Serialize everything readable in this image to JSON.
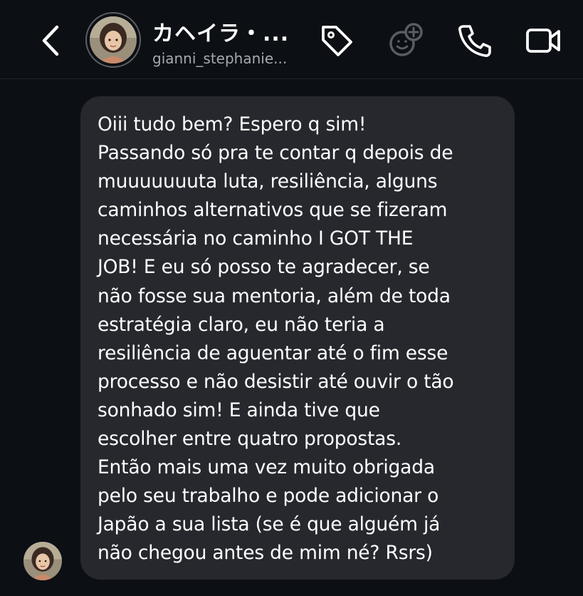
{
  "header": {
    "back_icon": "chevron-left-icon",
    "name": "カヘイラ・...",
    "username": "gianni_stephanie...",
    "icons": [
      "tag-icon",
      "add-sticker-icon",
      "phone-icon",
      "video-camera-icon"
    ]
  },
  "message": {
    "lines": [
      "Oiii tudo bem? Espero q sim!",
      "Passando só pra te contar q depois de",
      "muuuuuuuta luta, resiliência, alguns",
      "caminhos alternativos que se fizeram",
      "necessária no caminho I GOT THE",
      "JOB! E eu só posso te agradecer, se",
      "não fosse sua mentoria, além de toda",
      "estratégia claro, eu não teria a",
      "resiliência de aguentar até o fim esse",
      "processo e não desistir até ouvir o tão",
      "sonhado sim! E ainda tive que",
      "escolher entre quatro propostas.",
      "Então mais uma vez muito obrigada",
      "pelo seu trabalho e pode adicionar o",
      "Japão a sua lista (se é que alguém já",
      "não chegou antes de mim né? Rsrs)"
    ]
  },
  "colors": {
    "background": "#0c0f14",
    "bubble": "#26282e",
    "text": "#ffffff",
    "secondary_text": "#a6a9af"
  }
}
